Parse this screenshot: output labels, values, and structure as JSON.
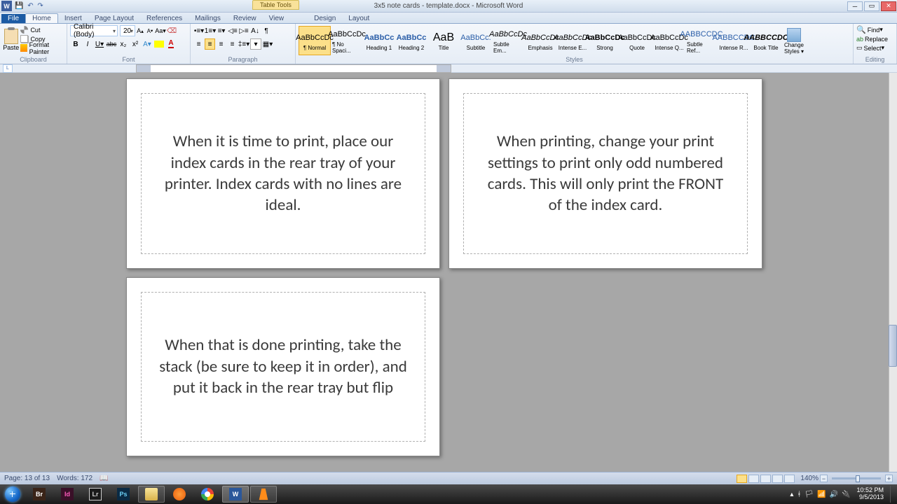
{
  "window": {
    "doc_title": "3x5 note cards - template.docx - Microsoft Word",
    "table_tools": "Table Tools"
  },
  "tabs": {
    "file": "File",
    "home": "Home",
    "insert": "Insert",
    "pagelayout": "Page Layout",
    "references": "References",
    "mailings": "Mailings",
    "review": "Review",
    "view": "View",
    "design": "Design",
    "layout": "Layout"
  },
  "clipboard": {
    "paste": "Paste",
    "cut": "Cut",
    "copy": "Copy",
    "fp": "Format Painter",
    "label": "Clipboard"
  },
  "font": {
    "name": "Calibri (Body)",
    "size": "20",
    "label": "Font"
  },
  "paragraph": {
    "label": "Paragraph"
  },
  "styles": {
    "label": "Styles",
    "items": [
      {
        "preview": "AaBbCcDc",
        "name": "¶ Normal"
      },
      {
        "preview": "AaBbCcDc",
        "name": "¶ No Spaci..."
      },
      {
        "preview": "AaBbCc",
        "name": "Heading 1"
      },
      {
        "preview": "AaBbCc",
        "name": "Heading 2"
      },
      {
        "preview": "AaB",
        "name": "Title"
      },
      {
        "preview": "AaBbCc.",
        "name": "Subtitle"
      },
      {
        "preview": "AaBbCcDc",
        "name": "Subtle Em..."
      },
      {
        "preview": "AaBbCcDc",
        "name": "Emphasis"
      },
      {
        "preview": "AaBbCcDc",
        "name": "Intense E..."
      },
      {
        "preview": "AaBbCcDc",
        "name": "Strong"
      },
      {
        "preview": "AaBbCcDc",
        "name": "Quote"
      },
      {
        "preview": "AaBbCcDc",
        "name": "Intense Q..."
      },
      {
        "preview": "AABBCCDC",
        "name": "Subtle Ref..."
      },
      {
        "preview": "AABBCCDC",
        "name": "Intense R..."
      },
      {
        "preview": "AABBCCDC",
        "name": "Book Title"
      }
    ],
    "change": "Change\nStyles"
  },
  "editing": {
    "find": "Find",
    "replace": "Replace",
    "select": "Select",
    "label": "Editing"
  },
  "cards": [
    "When it is time to print, place our index cards in the rear tray of your printer.  Index cards with no lines are ideal.",
    "When printing, change your print settings to print only odd numbered cards.  This will only print the FRONT of the index card.",
    "When that is done printing, take the stack (be sure to keep it in order), and put it back in the rear tray but flip"
  ],
  "status": {
    "page": "Page: 13 of 13",
    "words": "Words: 172",
    "zoom": "140%"
  },
  "tray": {
    "time": "10:52 PM",
    "date": "9/5/2013"
  }
}
